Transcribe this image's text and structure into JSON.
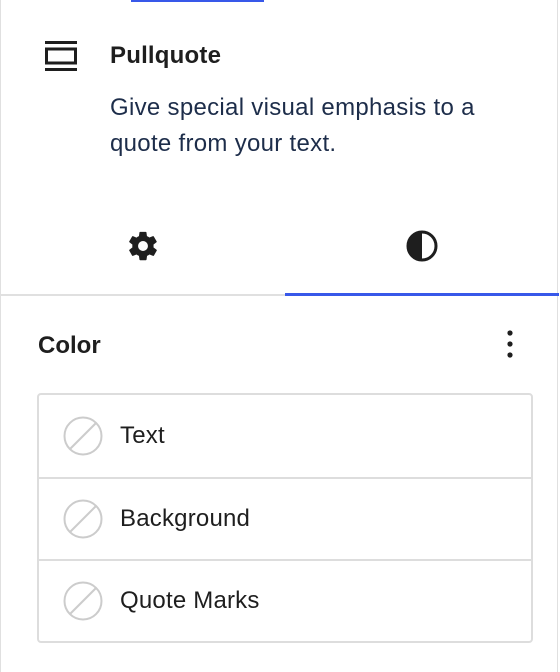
{
  "block": {
    "icon": "pullquote-icon",
    "title": "Pullquote",
    "description": "Give special visual emphasis to a quote from your text."
  },
  "tabs": [
    {
      "id": "settings",
      "icon": "gear-icon",
      "active": false
    },
    {
      "id": "styles",
      "icon": "half-circle-contrast-icon",
      "active": true
    }
  ],
  "color_panel": {
    "title": "Color",
    "options_icon": "vertical-ellipsis-icon",
    "items": [
      {
        "label": "Text",
        "swatch": "empty-color-swatch-icon"
      },
      {
        "label": "Background",
        "swatch": "empty-color-swatch-icon"
      },
      {
        "label": "Quote Marks",
        "swatch": "empty-color-swatch-icon"
      }
    ]
  },
  "colors": {
    "accent": "#3858e9",
    "text": "#1e1e1e",
    "description_text": "#1d2d4a",
    "border": "#dddddd"
  }
}
